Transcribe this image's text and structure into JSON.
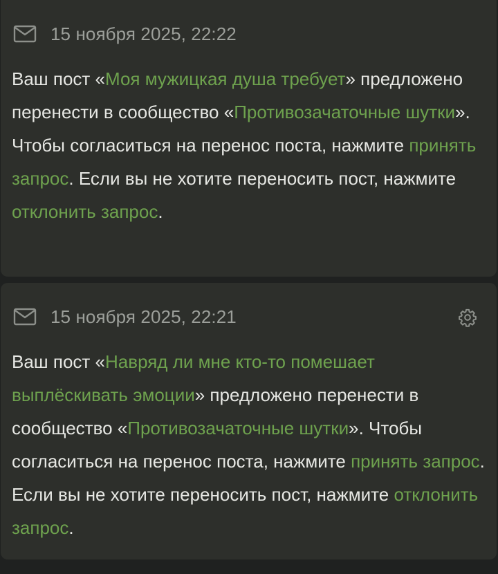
{
  "notifications": [
    {
      "date": "15 ноября 2025, 22:22",
      "has_settings": false,
      "parts": {
        "t1": "Ваш пост «",
        "post_title": "Моя мужицкая душа требует",
        "t2": "» предложено перенести в сообщество «",
        "community": "Противозачаточные шутки",
        "t3": "». Чтобы согласиться на перенос поста, нажмите ",
        "accept": "принять запрос",
        "t4": ". Если вы не хотите переносить пост, нажмите ",
        "decline": "отклонить запрос",
        "t5": "."
      }
    },
    {
      "date": "15 ноября 2025, 22:21",
      "has_settings": true,
      "parts": {
        "t1": "Ваш пост «",
        "post_title": "Навряд ли мне кто-то помешает выплёскивать эмоции",
        "t2": "» предложено перенести в сообщество «",
        "community": "Противозачаточные шутки",
        "t3": "». Чтобы согласиться на перенос поста, нажмите ",
        "accept": "принять запрос",
        "t4": ". Если вы не хотите переносить пост, нажмите ",
        "decline": "отклонить запрос",
        "t5": "."
      }
    }
  ],
  "icons": {
    "mail": "mail-icon",
    "settings": "gear-icon"
  },
  "colors": {
    "background": "#1f2120",
    "card": "#2d2f2b",
    "text": "#e6e7e3",
    "muted": "#9c9f9a",
    "link": "#6ea24e"
  }
}
